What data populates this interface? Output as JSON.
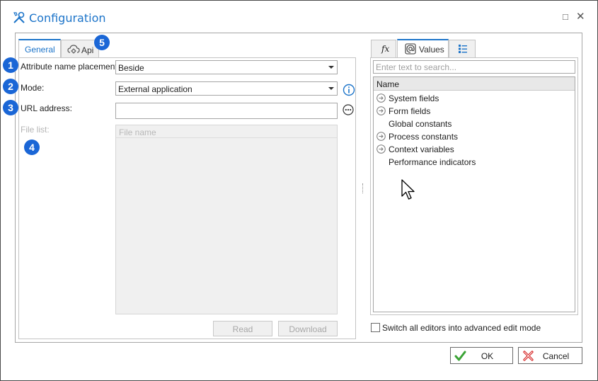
{
  "window": {
    "title": "Configuration",
    "maximize_glyph": "□",
    "close_glyph": "✕"
  },
  "left_tabs": [
    {
      "label": "General",
      "active": true
    },
    {
      "label": "Api",
      "active": false,
      "icon": "cloud-gear-icon"
    }
  ],
  "form": {
    "attribute_name_placement": {
      "label": "Attribute name placement:",
      "value": "Beside"
    },
    "mode": {
      "label": "Mode:",
      "value": "External application"
    },
    "url_address": {
      "label": "URL address:",
      "value": ""
    },
    "file_list": {
      "label": "File list:",
      "column_header": "File name"
    },
    "read_button": "Read",
    "download_button": "Download"
  },
  "badges": [
    "1",
    "2",
    "3",
    "4",
    "5"
  ],
  "right_tabs": [
    {
      "label": "",
      "icon": "fx-icon",
      "glyph": "fx",
      "active": false
    },
    {
      "label": "Values",
      "icon": "at-sign-icon",
      "active": true
    },
    {
      "label": "",
      "icon": "list-icon",
      "active": false
    }
  ],
  "values_panel": {
    "search_placeholder": "Enter text to search...",
    "column_header": "Name",
    "items": [
      {
        "label": "System fields",
        "expandable": true
      },
      {
        "label": "Form fields",
        "expandable": true
      },
      {
        "label": "Global constants",
        "expandable": false
      },
      {
        "label": "Process constants",
        "expandable": true
      },
      {
        "label": "Context variables",
        "expandable": true
      },
      {
        "label": "Performance indicators",
        "expandable": false
      }
    ]
  },
  "advanced_mode": {
    "label": "Switch all editors into advanced edit mode",
    "checked": false
  },
  "buttons": {
    "ok": "OK",
    "cancel": "Cancel"
  },
  "colors": {
    "accent": "#1c74c9",
    "badge": "#1a66d6",
    "ok_check": "#3aa335",
    "cancel_x": "#d42020"
  }
}
